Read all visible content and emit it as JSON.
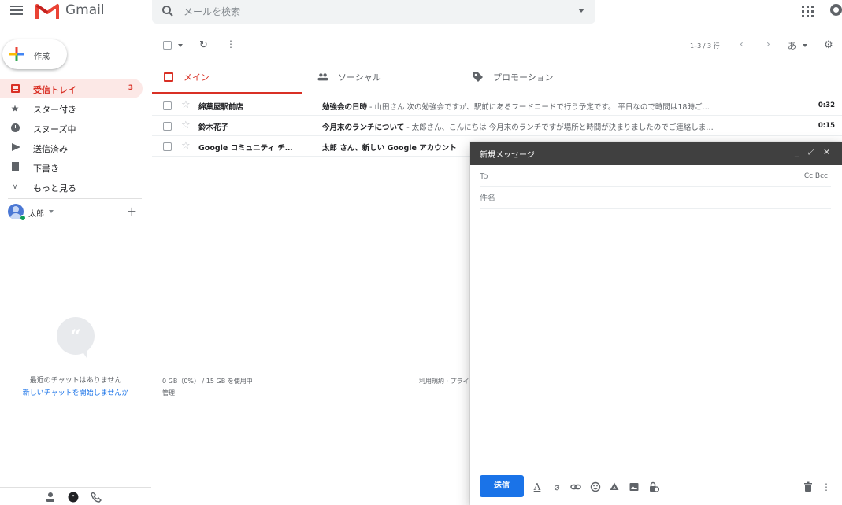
{
  "header": {
    "app_name": "Gmail",
    "search_placeholder": "メールを検索",
    "icons": [
      "menu-icon",
      "gmail-logo",
      "search-icon",
      "apps-icon",
      "account-icon"
    ]
  },
  "sidebar": {
    "compose_label": "作成",
    "items": [
      {
        "label": "受信トレイ",
        "count": "3",
        "icon": "inbox-icon",
        "active": true
      },
      {
        "label": "スター付き",
        "icon": "star-icon"
      },
      {
        "label": "スヌーズ中",
        "icon": "clock-icon"
      },
      {
        "label": "送信済み",
        "icon": "send-icon"
      },
      {
        "label": "下書き",
        "icon": "draft-icon"
      },
      {
        "label": "もっと見る",
        "icon": "chevron-down-icon"
      }
    ],
    "user_name": "太郎",
    "chat_empty": "最近のチャットはありません",
    "chat_start": "新しいチャットを開始しませんか"
  },
  "toolbar": {
    "range": "1–3 / 3 行",
    "lang": "あ"
  },
  "tabs": [
    {
      "label": "メイン",
      "active": true,
      "icon": "inbox-icon"
    },
    {
      "label": "ソーシャル",
      "icon": "people-icon"
    },
    {
      "label": "プロモーション",
      "icon": "tag-icon"
    }
  ],
  "emails": [
    {
      "sender": "綿菓屋駅前店",
      "subject": "勉強会の日時",
      "snippet": " - 山田さん 次の勉強会ですが、駅前にあるフードコードで行う予定です。 平日なので時間は18時ご…",
      "time": "0:32"
    },
    {
      "sender": "鈴木花子",
      "subject": "今月末のランチについて",
      "snippet": " - 太郎さん、こんにちは 今月末のランチですが場所と時間が決まりましたのでご連絡しま…",
      "time": "0:15"
    },
    {
      "sender": "Google コミュニティ チ…",
      "subject": "太郎 さん、新しい Google アカウント",
      "snippet": "",
      "time": ""
    }
  ],
  "footer": {
    "usage": "0 GB（0%） / 15 GB を使用中",
    "manage": "管理",
    "terms": "利用規約 · プライバシー"
  },
  "compose_window": {
    "title": "新規メッセージ",
    "to_placeholder": "To",
    "cc_bcc": "Cc Bcc",
    "subject_placeholder": "件名",
    "send_label": "送信",
    "tools": [
      "format-text-icon",
      "attach-icon",
      "link-icon",
      "emoji-icon",
      "drive-icon",
      "photo-icon",
      "confidential-icon",
      "trash-icon",
      "more-options-icon"
    ]
  },
  "colors": {
    "accent_red": "#d93025",
    "send_blue": "#1a73e8",
    "compose_header": "#404040"
  }
}
